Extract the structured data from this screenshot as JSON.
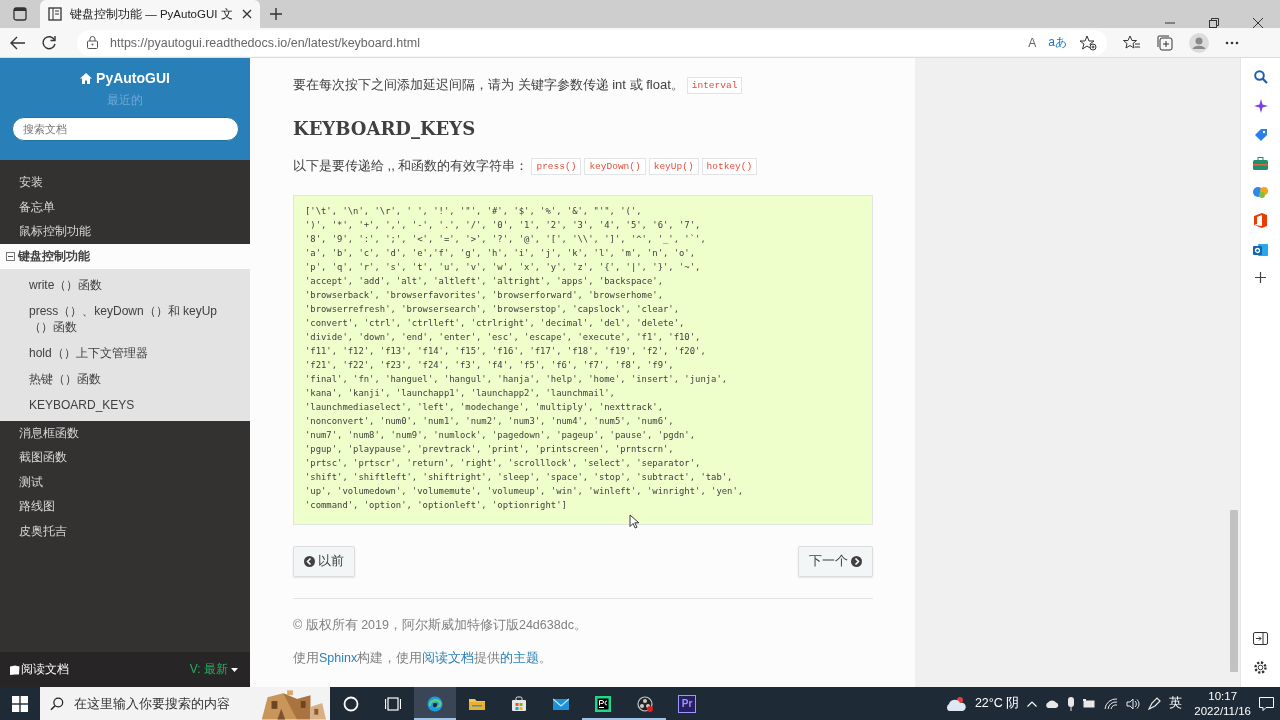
{
  "browser": {
    "tab": {
      "title": "键盘控制功能 — PyAutoGUI 文",
      "selected": true
    },
    "address": {
      "url": "https://pyautogui.readthedocs.io/en/latest/keyboard.html",
      "read_aloud_glyph": "A",
      "translate_glyph": "aあ"
    }
  },
  "sidebar": {
    "title": "PyAutoGUI",
    "version": "最近的",
    "search": {
      "placeholder": "搜索文档"
    },
    "nav": [
      {
        "label": "安装",
        "selected": false
      },
      {
        "label": "备忘单",
        "selected": false
      },
      {
        "label": "鼠标控制功能",
        "selected": false
      },
      {
        "label": "键盘控制功能",
        "selected": true,
        "expanded": true,
        "children": [
          {
            "label": "write（）函数"
          },
          {
            "label": "press（）、keyDown（）和 keyUp（）函数"
          },
          {
            "label": "hold（）上下文管理器"
          },
          {
            "label": "热键（）函数"
          },
          {
            "label": "KEYBOARD_KEYS"
          }
        ]
      },
      {
        "label": "消息框函数",
        "selected": false
      },
      {
        "label": "截图函数",
        "selected": false
      },
      {
        "label": "测试",
        "selected": false
      },
      {
        "label": "路线图",
        "selected": false
      },
      {
        "label": "皮奥托吉",
        "selected": false
      }
    ],
    "footer": {
      "label": "阅读文档",
      "version": "V: 最新"
    }
  },
  "content": {
    "intro": {
      "text": "要在每次按下之间添加延迟间隔，请为 关键字参数传递 int 或 float。",
      "codes": [
        "interval"
      ]
    },
    "heading": "KEYBOARD_KEYS",
    "lead": {
      "text": "以下是要传递给 ,, 和函数的有效字符串：",
      "codes": [
        "press()",
        "keyDown()",
        "keyUp()",
        "hotkey()"
      ]
    },
    "code_block": {
      "lines": [
        "['\\t', '\\n', '\\r', ' ', '!', '\"', '#', '$', '%', '&', \"'\", '(',",
        "')', '*', '+', ',', '-', '.', '/', '0', '1', '2', '3', '4', '5', '6', '7',",
        "'8', '9', ':', ';', '<', '=', '>', '?', '@', '[', '\\\\', ']', '^', '_', '`',",
        "'a', 'b', 'c', 'd', 'e','f', 'g', 'h', 'i', 'j', 'k', 'l', 'm', 'n', 'o',",
        "'p', 'q', 'r', 's', 't', 'u', 'v', 'w', 'x', 'y', 'z', '{', '|', '}', '~',",
        "'accept', 'add', 'alt', 'altleft', 'altright', 'apps', 'backspace',",
        "'browserback', 'browserfavorites', 'browserforward', 'browserhome',",
        "'browserrefresh', 'browsersearch', 'browserstop', 'capslock', 'clear',",
        "'convert', 'ctrl', 'ctrlleft', 'ctrlright', 'decimal', 'del', 'delete',",
        "'divide', 'down', 'end', 'enter', 'esc', 'escape', 'execute', 'f1', 'f10',",
        "'f11', 'f12', 'f13', 'f14', 'f15', 'f16', 'f17', 'f18', 'f19', 'f2', 'f20',",
        "'f21', 'f22', 'f23', 'f24', 'f3', 'f4', 'f5', 'f6', 'f7', 'f8', 'f9',",
        "'final', 'fn', 'hanguel', 'hangul', 'hanja', 'help', 'home', 'insert', 'junja',",
        "'kana', 'kanji', 'launchapp1', 'launchapp2', 'launchmail',",
        "'launchmediaselect', 'left', 'modechange', 'multiply', 'nexttrack',",
        "'nonconvert', 'num0', 'num1', 'num2', 'num3', 'num4', 'num5', 'num6',",
        "'num7', 'num8', 'num9', 'numlock', 'pagedown', 'pageup', 'pause', 'pgdn',",
        "'pgup', 'playpause', 'prevtrack', 'print', 'printscreen', 'prntscrn',",
        "'prtsc', 'prtscr', 'return', 'right', 'scrolllock', 'select', 'separator',",
        "'shift', 'shiftleft', 'shiftright', 'sleep', 'space', 'stop', 'subtract', 'tab',",
        "'up', 'volumedown', 'volumemute', 'volumeup', 'win', 'winleft', 'winright', 'yen',",
        "'command', 'option', 'optionleft', 'optionright']"
      ]
    },
    "pager": {
      "previous": "以前",
      "next": "下一个"
    },
    "footer": {
      "copyright": "© 版权所有 2019，阿尔斯威加特修订版24d638dc。",
      "built_with": [
        {
          "text": "使用",
          "link": false
        },
        {
          "text": "Sphinx",
          "link": true
        },
        {
          "text": "构建，使用",
          "link": false
        },
        {
          "text": "阅读文档",
          "link": true
        },
        {
          "text": "提供",
          "link": false
        },
        {
          "text": "的主题",
          "link": true
        },
        {
          "text": "。",
          "link": false
        }
      ]
    }
  },
  "taskbar": {
    "search": {
      "placeholder": "在这里输入你要搜索的内容"
    },
    "apps": [
      {
        "kind": "cortana",
        "selected": false,
        "running": false
      },
      {
        "kind": "taskview",
        "selected": false,
        "running": false
      },
      {
        "kind": "edge",
        "selected": true,
        "running": true
      },
      {
        "kind": "explorer",
        "selected": false,
        "running": false
      },
      {
        "kind": "store",
        "selected": false,
        "running": false
      },
      {
        "kind": "mail",
        "selected": false,
        "running": false
      },
      {
        "kind": "pycharm",
        "selected": false,
        "running": true
      },
      {
        "kind": "recorder",
        "selected": false,
        "running": true
      },
      {
        "kind": "premiere",
        "selected": false,
        "running": false,
        "label": "Pr"
      }
    ],
    "weather": "22°C 阴",
    "ime": "英",
    "time": "10:17",
    "date": "2022/11/16"
  }
}
